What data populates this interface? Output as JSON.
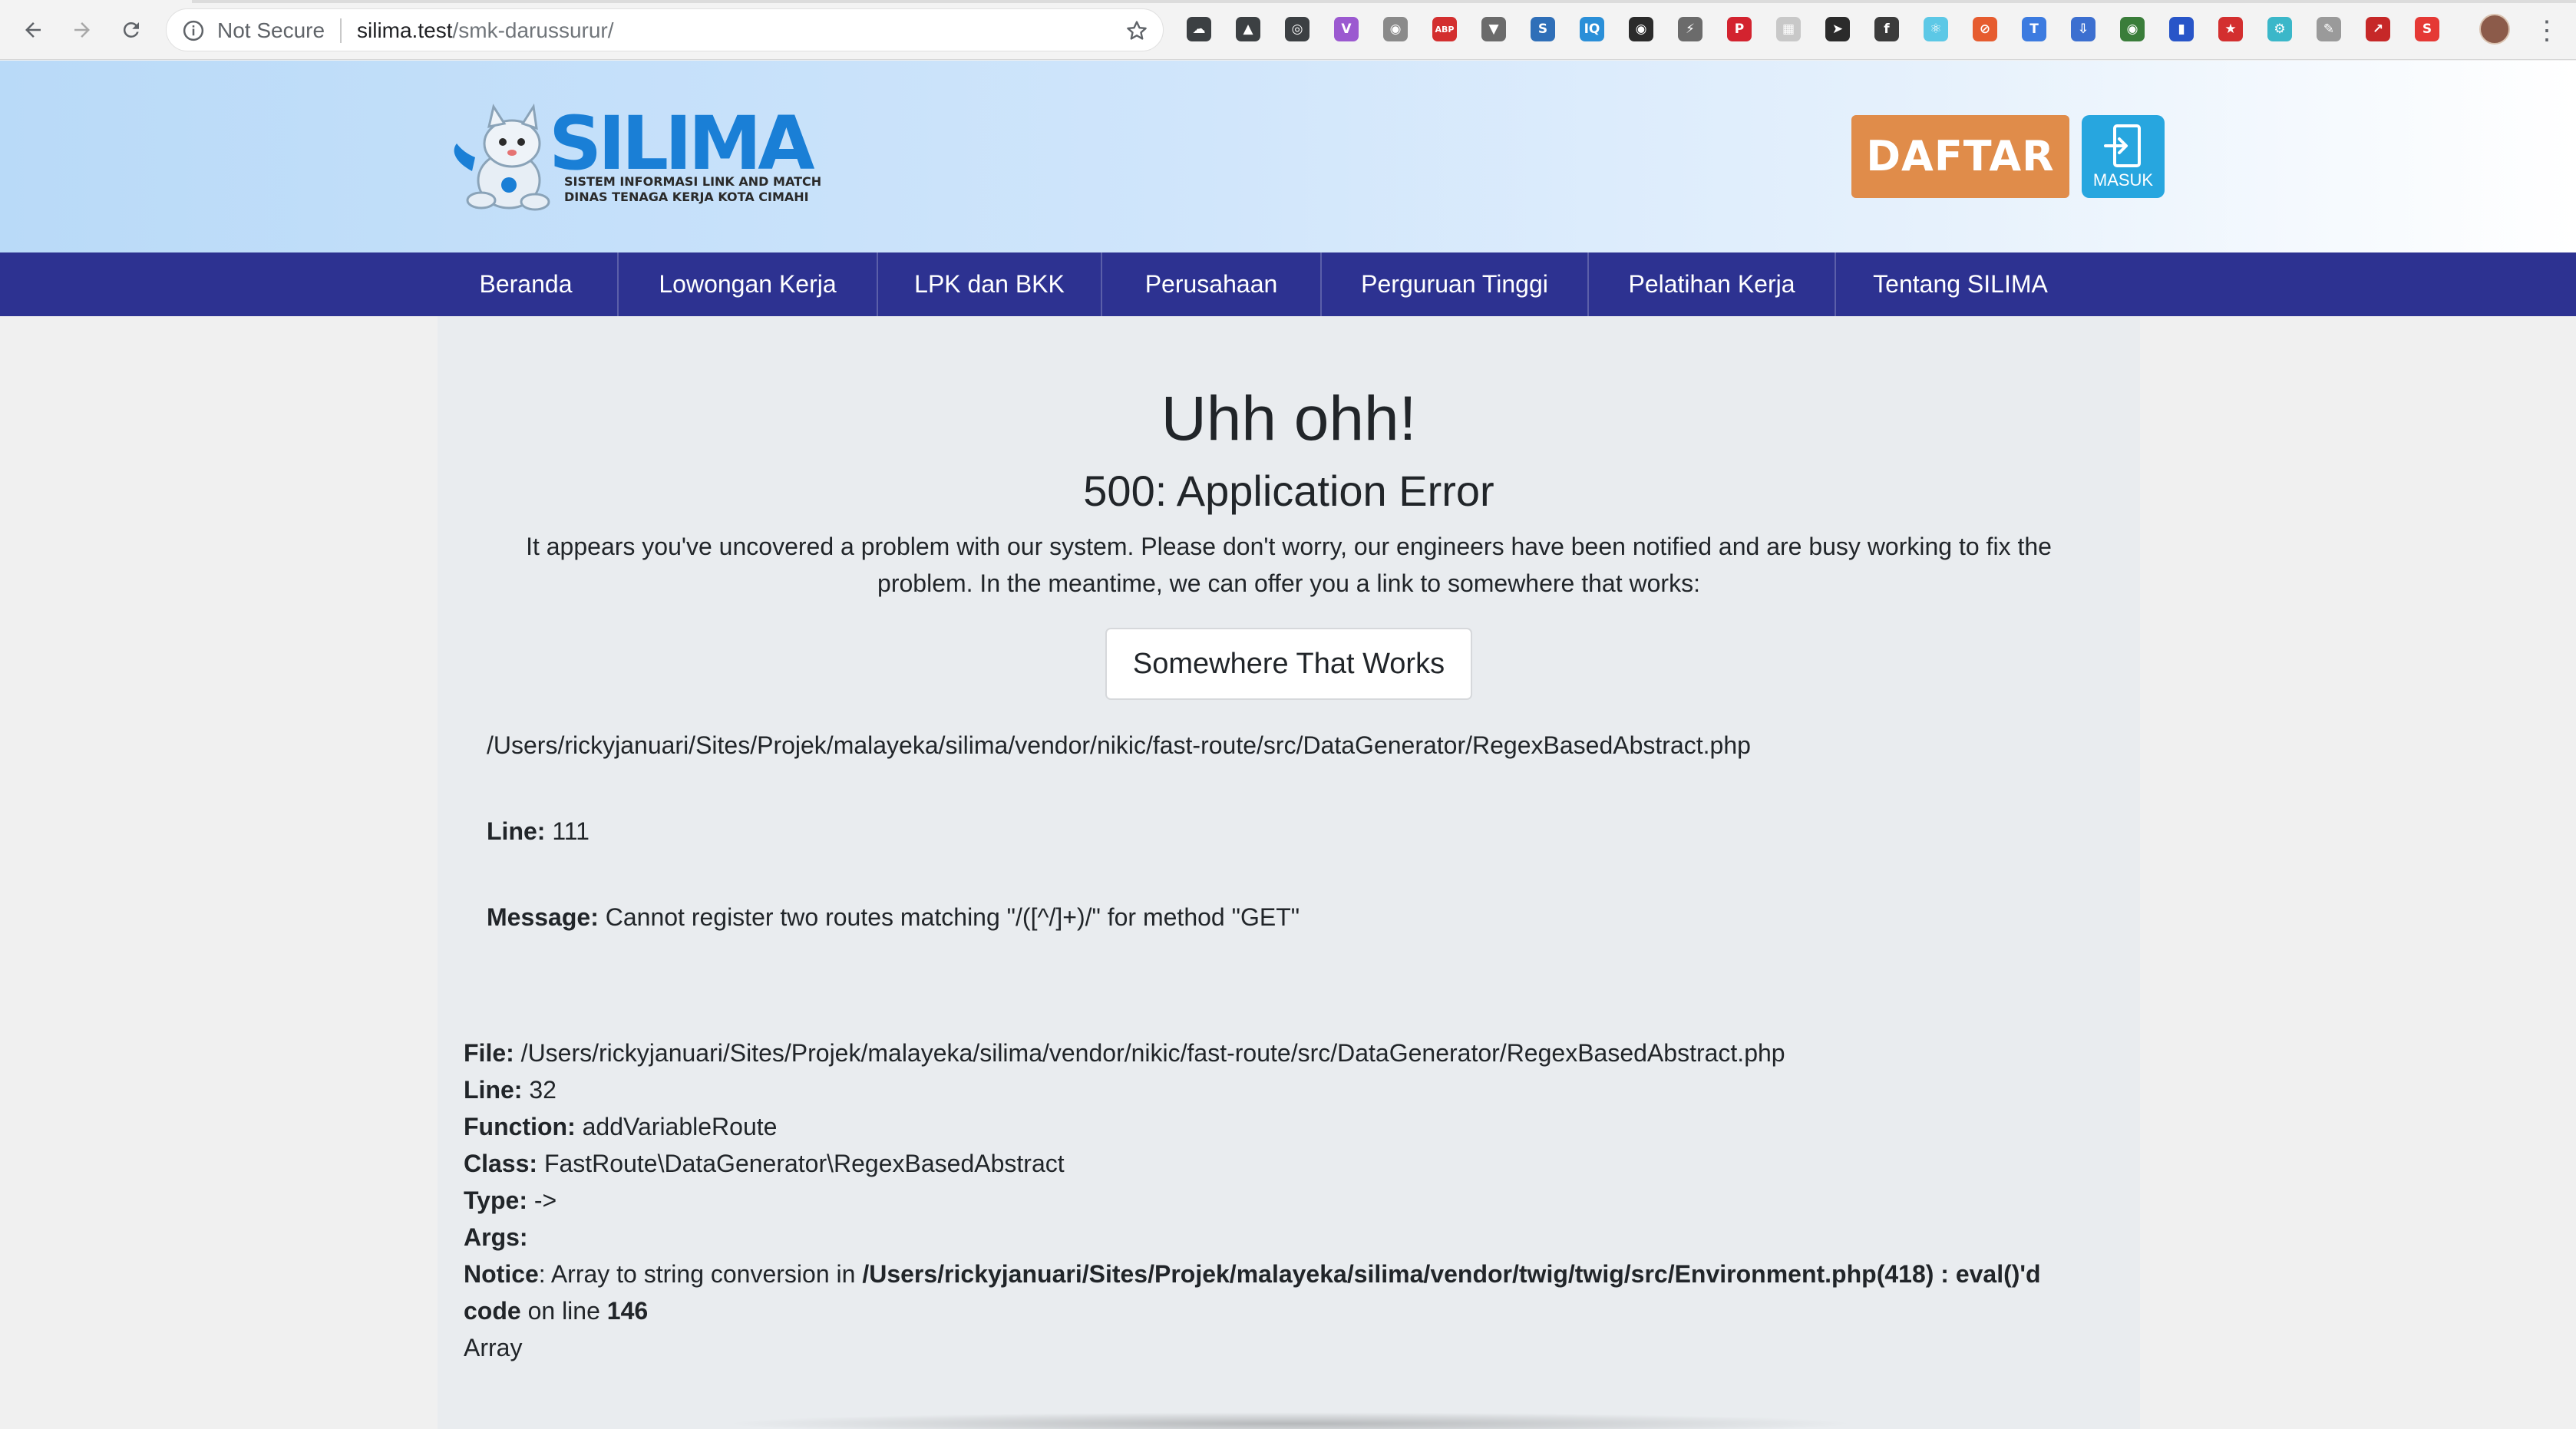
{
  "browser": {
    "security_label": "Not Secure",
    "url_host": "silima.test",
    "url_path": "/smk-darussurur/",
    "extensions": [
      {
        "name": "cloud-ext-icon",
        "color": "#3c4043",
        "glyph": "☁"
      },
      {
        "name": "drive-ext-icon",
        "color": "#3c4043",
        "glyph": "▲"
      },
      {
        "name": "opera-ext-icon",
        "color": "#3c4043",
        "glyph": "◎"
      },
      {
        "name": "vivaldi-ext-icon",
        "color": "#9b59d0",
        "glyph": "V"
      },
      {
        "name": "camera-ext-icon",
        "color": "#8a8a8a",
        "glyph": "◉"
      },
      {
        "name": "adblock-plus-icon",
        "color": "#d32f2f",
        "glyph": "ABP"
      },
      {
        "name": "vue-devtools-icon",
        "color": "#6b6b6b",
        "glyph": "▼"
      },
      {
        "name": "screenshot-ext-icon",
        "color": "#2f6fb8",
        "glyph": "S"
      },
      {
        "name": "iq-ext-icon",
        "color": "#2a8fd8",
        "glyph": "IQ"
      },
      {
        "name": "incognito-ext-icon",
        "color": "#2b2b2b",
        "glyph": "◉"
      },
      {
        "name": "lightning-ext-icon",
        "color": "#6b6b6b",
        "glyph": "⚡"
      },
      {
        "name": "pinterest-icon",
        "color": "#d3232f",
        "glyph": "P"
      },
      {
        "name": "grid-ext-icon",
        "color": "#c8c8c8",
        "glyph": "▦"
      },
      {
        "name": "pointer-ext-icon",
        "color": "#2b2b2b",
        "glyph": "➤"
      },
      {
        "name": "facebook-ext-icon",
        "color": "#3b3b3b",
        "glyph": "f"
      },
      {
        "name": "react-devtools-icon",
        "color": "#5cc8e6",
        "glyph": "⚛"
      },
      {
        "name": "block-ext-icon",
        "color": "#e65c2f",
        "glyph": "⊘"
      },
      {
        "name": "translate-ext-icon",
        "color": "#3c7be0",
        "glyph": "T"
      },
      {
        "name": "download-ext-icon",
        "color": "#3c6fd0",
        "glyph": "⇩"
      },
      {
        "name": "color-picker-icon",
        "color": "#3a7d3a",
        "glyph": "◉"
      },
      {
        "name": "bookmark-ext-icon",
        "color": "#2855c8",
        "glyph": "▮"
      },
      {
        "name": "star-badge-ext-icon",
        "color": "#d32f2f",
        "glyph": "★"
      },
      {
        "name": "gear-ext-icon",
        "color": "#3bb7c9",
        "glyph": "⚙"
      },
      {
        "name": "note-ext-icon",
        "color": "#9a9a9a",
        "glyph": "✎"
      },
      {
        "name": "pdf-ext-icon",
        "color": "#c62828",
        "glyph": "↗"
      },
      {
        "name": "s-ext-icon",
        "color": "#e53935",
        "glyph": "S"
      }
    ]
  },
  "header": {
    "logo_text": "SILIMA",
    "logo_subtitle": "SISTEM INFORMASI LINK AND MATCH\nDINAS TENAGA KERJA KOTA CIMAHI",
    "daftar_label": "DAFTAR",
    "masuk_label": "MASUK"
  },
  "nav": {
    "items": [
      {
        "label": "Beranda"
      },
      {
        "label": "Lowongan Kerja"
      },
      {
        "label": "LPK dan BKK"
      },
      {
        "label": "Perusahaan"
      },
      {
        "label": "Perguruan Tinggi"
      },
      {
        "label": "Pelatihan Kerja"
      },
      {
        "label": "Tentang SILIMA"
      }
    ]
  },
  "error": {
    "title": "Uhh ohh!",
    "subtitle": "500: Application Error",
    "message": "It appears you've uncovered a problem with our system. Please don't worry, our engineers have been notified and are busy working to fix the problem. In the meantime, we can offer you a link to somewhere that works:",
    "button_label": "Somewhere That Works",
    "file_path": "/Users/rickyjanuari/Sites/Projek/malayeka/silima/vendor/nikic/fast-route/src/DataGenerator/RegexBasedAbstract.php",
    "line_label": "Line:",
    "line_value": "111",
    "message_label": "Message:",
    "message_value": "Cannot register two routes matching \"/([^/]+)/\" for method \"GET\""
  },
  "trace": {
    "file_label": "File:",
    "file_value": "/Users/rickyjanuari/Sites/Projek/malayeka/silima/vendor/nikic/fast-route/src/DataGenerator/RegexBasedAbstract.php",
    "line_label": "Line:",
    "line_value": "32",
    "function_label": "Function:",
    "function_value": "addVariableRoute",
    "class_label": "Class:",
    "class_value": "FastRoute\\DataGenerator\\RegexBasedAbstract",
    "type_label": "Type:",
    "type_value": "->",
    "args_label": "Args:",
    "notice_label": "Notice",
    "notice_text": ": Array to string conversion in ",
    "notice_path": "/Users/rickyjanuari/Sites/Projek/malayeka/silima/vendor/twig/twig/src/Environment.php(418) : eval()'d",
    "notice_code": "code",
    "notice_online": " on line ",
    "notice_line": "146",
    "array_text": "Array"
  }
}
